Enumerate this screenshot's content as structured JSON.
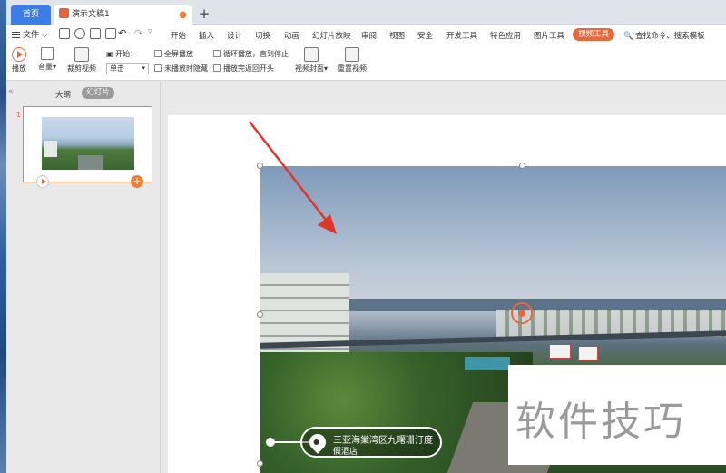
{
  "tabs": {
    "home": "首页",
    "doc": "演示文稿1"
  },
  "menu": {
    "file": "文件",
    "items": [
      "开始",
      "插入",
      "设计",
      "切换",
      "动画",
      "幻灯片放映",
      "审阅",
      "视图",
      "安全",
      "开发工具",
      "特色应用",
      "图片工具"
    ],
    "active": "视频工具",
    "search": "查找命令、搜索模板"
  },
  "toolbar": {
    "play": "播放",
    "volume": "音量",
    "trim": "裁剪视频",
    "start_label": "开始：",
    "start_value": "单击",
    "fullscreen": "全屏播放",
    "hide_when_not_playing": "未播放时隐藏",
    "loop": "循环播放，直到停止",
    "rewind": "播放完返回开头",
    "cover": "视频封面",
    "reset": "重置视频"
  },
  "panel": {
    "outline": "大纲",
    "slides": "幻灯片",
    "slide_number": "1"
  },
  "video": {
    "caption_line1": "三亚海棠湾区九曙珊汀度",
    "caption_line2": "假酒店"
  },
  "watermark": "软件技巧",
  "colors": {
    "accent": "#e8683b",
    "tab_blue": "#3d7ee6",
    "arrow": "#e0352b"
  }
}
